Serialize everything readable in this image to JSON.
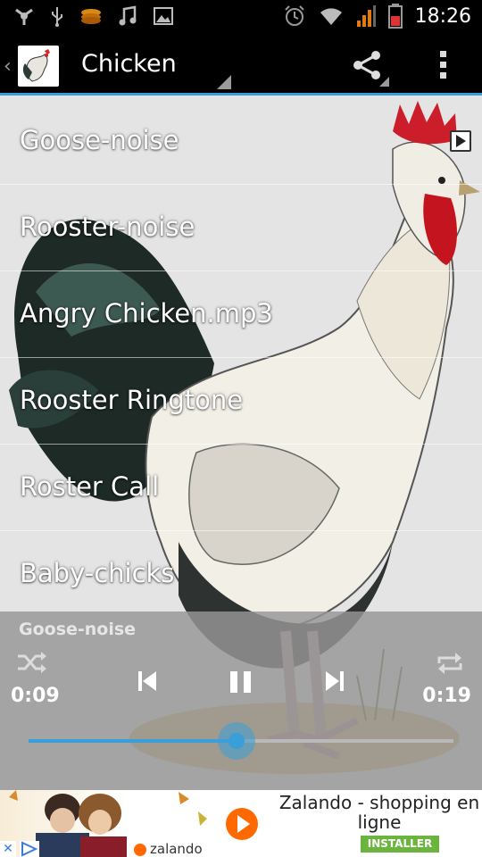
{
  "status_bar": {
    "time": "18:26",
    "left_icons": [
      "notification-icon",
      "usb-icon",
      "coin-stack-icon",
      "music-note-icon",
      "image-icon"
    ],
    "right_icons": [
      "alarm-icon",
      "wifi-icon",
      "signal-icon",
      "battery-icon"
    ]
  },
  "action_bar": {
    "title": "Chicken",
    "actions": [
      "share-icon",
      "overflow-menu-icon"
    ]
  },
  "sounds": [
    {
      "label": "Goose-noise"
    },
    {
      "label": "Rooster-noise"
    },
    {
      "label": "Angry Chicken.mp3"
    },
    {
      "label": "Rooster Ringtone"
    },
    {
      "label": "Roster Call"
    },
    {
      "label": "Baby-chicks"
    }
  ],
  "player": {
    "now_playing": "Goose-noise",
    "current_time": "0:09",
    "total_time": "0:19",
    "progress": 0.49
  },
  "ad": {
    "headline": "Zalando - shopping en ligne",
    "cta": "INSTALLER",
    "brand": "zalando"
  },
  "colors": {
    "accent": "#3a9ed8",
    "install_green": "#6bb53e",
    "brand_orange": "#ff6900"
  }
}
